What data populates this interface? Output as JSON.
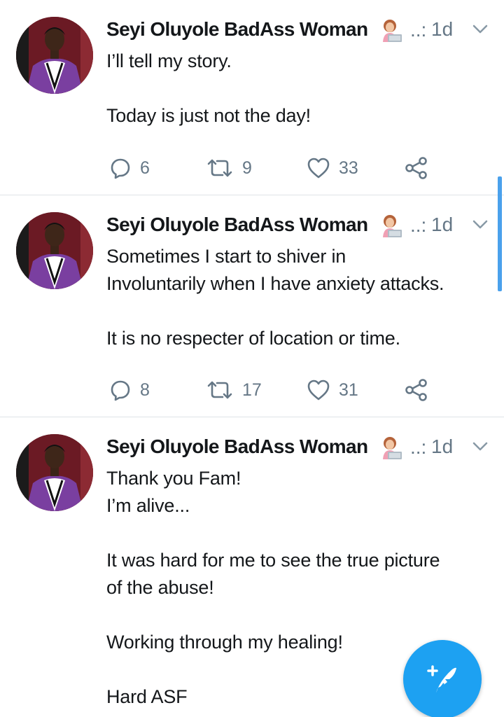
{
  "colors": {
    "text": "#14171a",
    "secondary": "#657786",
    "accent": "#1da1f2",
    "divider": "#dfe3e7"
  },
  "tweets": [
    {
      "author": "Seyi Oluyole BadAss Woman",
      "emoji": "woman-technologist-emoji",
      "truncation": "..:",
      "time": "1d",
      "text": [
        "I’ll tell my story.",
        "",
        "Today is just not the day!"
      ],
      "replies": "6",
      "retweets": "9",
      "likes": "33"
    },
    {
      "author": "Seyi Oluyole BadAss Woman",
      "emoji": "woman-technologist-emoji",
      "truncation": "..:",
      "time": "1d",
      "text": [
        "Sometimes I start to shiver in",
        "Involuntarily when I have anxiety attacks.",
        "",
        "It is no respecter of location or time."
      ],
      "replies": "8",
      "retweets": "17",
      "likes": "31"
    },
    {
      "author": "Seyi Oluyole BadAss Woman",
      "emoji": "woman-technologist-emoji",
      "truncation": "..:",
      "time": "1d",
      "text": [
        "Thank you Fam!",
        "I’m alive...",
        "",
        "It was hard for me to see the true picture",
        "of the abuse!",
        "",
        "Working through my healing!",
        "",
        "Hard ASF"
      ]
    }
  ],
  "fab": {
    "icon": "compose-tweet-icon"
  }
}
